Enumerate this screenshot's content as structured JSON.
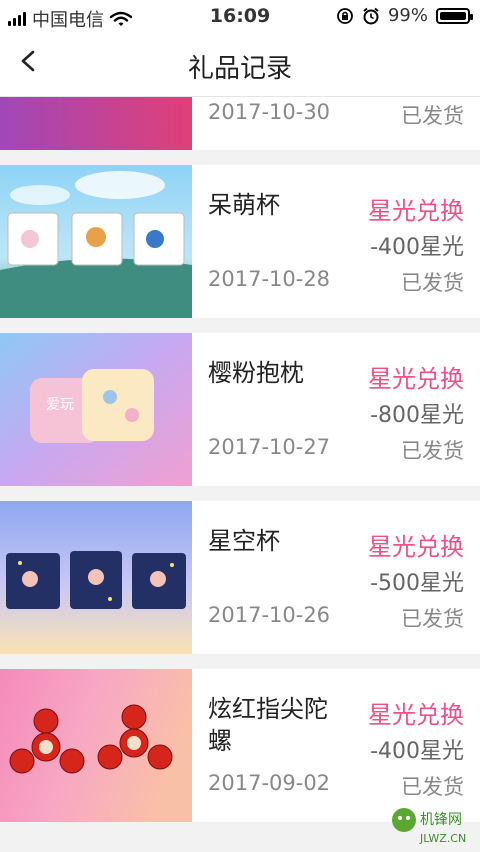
{
  "status_bar": {
    "carrier": "中国电信",
    "time": "16:09",
    "battery": "99%",
    "battery_level": 0.99,
    "icons": [
      "signal-icon",
      "wifi-icon",
      "rotation-lock-icon",
      "alarm-icon",
      "battery-icon"
    ]
  },
  "nav": {
    "title": "礼品记录",
    "back_icon": "chevron-left-icon"
  },
  "gifts": [
    {
      "name": "",
      "method": "",
      "cost": "",
      "date": "2017-10-30",
      "status": "已发货"
    },
    {
      "name": "呆萌杯",
      "method": "星光兑换",
      "cost": "-400星光",
      "date": "2017-10-28",
      "status": "已发货"
    },
    {
      "name": "樱粉抱枕",
      "method": "星光兑换",
      "cost": "-800星光",
      "date": "2017-10-27",
      "status": "已发货"
    },
    {
      "name": "星空杯",
      "method": "星光兑换",
      "cost": "-500星光",
      "date": "2017-10-26",
      "status": "已发货"
    },
    {
      "name": "炫红指尖陀螺",
      "method": "星光兑换",
      "cost": "-400星光",
      "date": "2017-09-02",
      "status": "已发货"
    }
  ],
  "pillow_text": "爱玩",
  "watermark": {
    "line1": "机锋网",
    "line2": "JLWZ.CN"
  },
  "colors": {
    "accent": "#f0508a",
    "background": "#f2f2f2"
  }
}
